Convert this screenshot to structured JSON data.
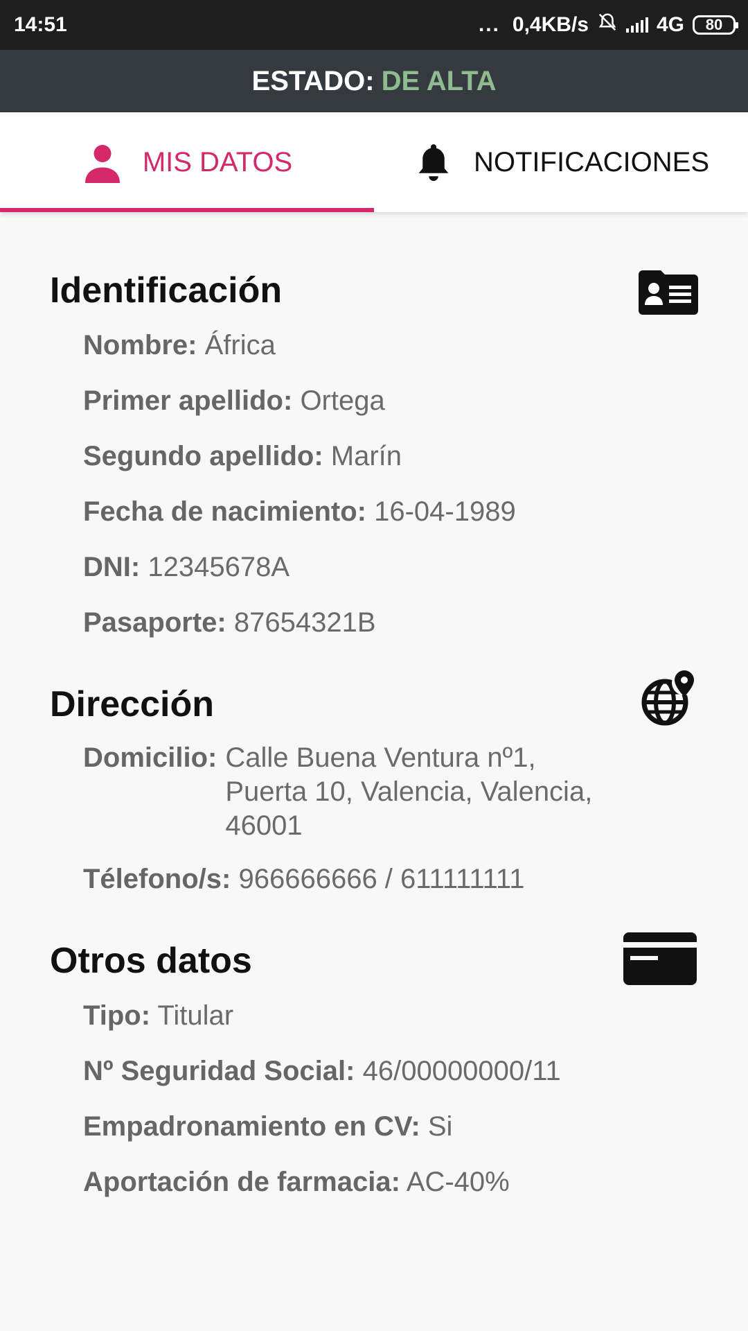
{
  "status_bar": {
    "time": "14:51",
    "dots": "...",
    "speed": "0,4KB/s",
    "network": "4G",
    "battery": "80",
    "icons": [
      "mute-bell-icon",
      "signal-icon",
      "battery-icon"
    ]
  },
  "estado": {
    "label": "ESTADO:",
    "value": "DE ALTA",
    "value_color": "#8fbc8f"
  },
  "tabs": [
    {
      "label": "MIS DATOS",
      "icon": "person-icon",
      "active": true
    },
    {
      "label": "NOTIFICACIONES",
      "icon": "bell-icon",
      "active": false
    }
  ],
  "accent_color": "#d5286a",
  "identificacion": {
    "title": "Identificación",
    "icon": "id-card-icon",
    "fields": [
      {
        "label": "Nombre:",
        "value": "África"
      },
      {
        "label": "Primer apellido:",
        "value": "Ortega"
      },
      {
        "label": "Segundo apellido:",
        "value": "Marín"
      },
      {
        "label": "Fecha de nacimiento:",
        "value": "16-04-1989"
      },
      {
        "label": "DNI:",
        "value": "12345678A"
      },
      {
        "label": "Pasaporte:",
        "value": "87654321B"
      }
    ]
  },
  "direccion": {
    "title": "Dirección",
    "icon": "globe-pin-icon",
    "fields": [
      {
        "label": "Domicilio:",
        "value": "Calle Buena Ventura nº1, Puerta 10, Valencia, Valencia, 46001"
      },
      {
        "label": "Télefono/s:",
        "value": "966666666 / 611111111"
      }
    ]
  },
  "otros": {
    "title": "Otros datos",
    "icon": "credit-card-icon",
    "fields": [
      {
        "label": "Tipo:",
        "value": "Titular"
      },
      {
        "label": "Nº Seguridad Social:",
        "value": "46/00000000/11"
      },
      {
        "label": "Empadronamiento en CV:",
        "value": "Si"
      },
      {
        "label": "Aportación de farmacia:",
        "value": "AC-40%"
      }
    ]
  }
}
